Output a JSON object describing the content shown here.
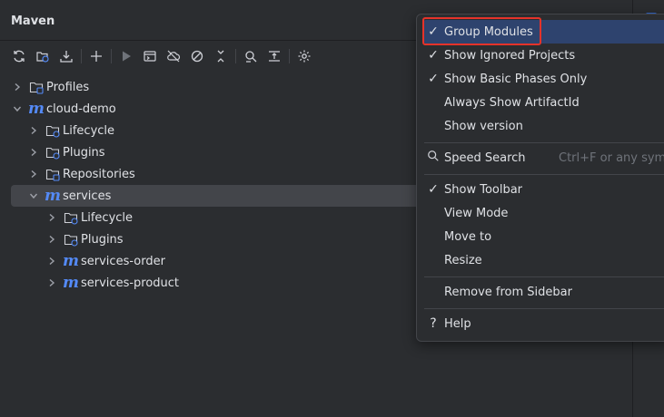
{
  "panel": {
    "title": "Maven"
  },
  "toolbar": {
    "icons": [
      "reload-icon",
      "import-icon",
      "download-icon",
      "add-icon",
      "run-icon",
      "execute-goal-icon",
      "offline-icon",
      "skip-tests-icon",
      "collapse-icon",
      "show-dependencies-icon",
      "expand-collapse-icon",
      "settings-icon"
    ]
  },
  "tree": {
    "profiles": "Profiles",
    "cloud_demo": "cloud-demo",
    "lifecycle": "Lifecycle",
    "plugins": "Plugins",
    "repositories": "Repositories",
    "services": "services",
    "services_lifecycle": "Lifecycle",
    "services_plugins": "Plugins",
    "services_order": "services-order",
    "services_product": "services-product"
  },
  "menu": {
    "group_modules": "Group Modules",
    "show_ignored": "Show Ignored Projects",
    "show_basic_phases": "Show Basic Phases Only",
    "always_show_artifact": "Always Show ArtifactId",
    "show_version": "Show version",
    "speed_search": "Speed Search",
    "speed_search_shortcut": "Ctrl+F or any symbo",
    "show_toolbar": "Show Toolbar",
    "view_mode": "View Mode",
    "move_to": "Move to",
    "resize": "Resize",
    "remove_from_sidebar": "Remove from Sidebar",
    "help": "Help",
    "check_glyph": "✓",
    "help_glyph": "?",
    "arrow_glyph": "›",
    "m_glyph": "m"
  },
  "colors": {
    "background": "#2b2d30",
    "highlight": "#2e436e",
    "accent": "#548af7",
    "annotation_red": "#e5332a"
  }
}
